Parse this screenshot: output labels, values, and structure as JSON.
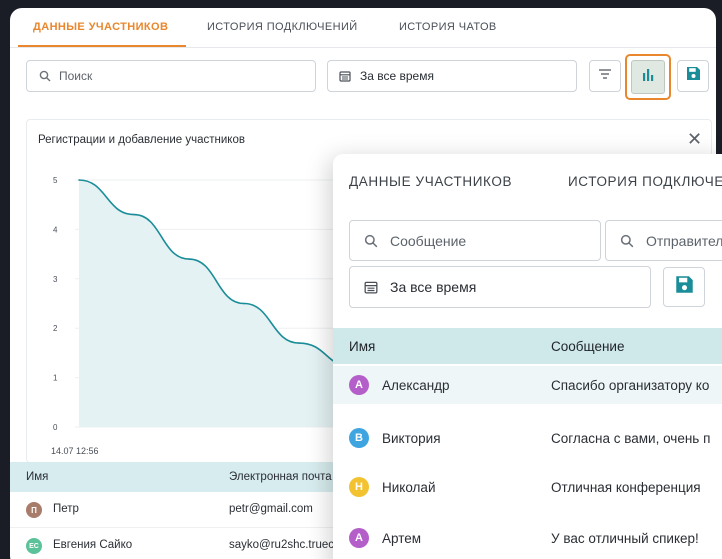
{
  "main_window": {
    "tabs": [
      {
        "label": "ДАННЫЕ УЧАСТНИКОВ",
        "active": true
      },
      {
        "label": "ИСТОРИЯ ПОДКЛЮЧЕНИЙ",
        "active": false
      },
      {
        "label": "ИСТОРИЯ ЧАТОВ",
        "active": false
      }
    ],
    "search": {
      "placeholder": "Поиск"
    },
    "period": {
      "value": "За все время"
    },
    "toolbar": {
      "filter_icon": "filter-lines-icon",
      "chart_icon": "bar-chart-icon",
      "save_icon": "save-disk-icon"
    },
    "chart": {
      "title": "Регистрации и добавление участников",
      "close_label": "✕",
      "y_ticks": [
        "5",
        "4",
        "3",
        "2",
        "1",
        "0"
      ],
      "x_first_label": "14.07 12:56"
    },
    "table": {
      "columns": [
        "Имя",
        "Электронная почта"
      ],
      "rows": [
        {
          "initials": "П",
          "name": "Петр",
          "email": "petr@gmail.com",
          "color": "#a87c6a"
        },
        {
          "initials": "ЕС",
          "name": "Евгения Сайко",
          "email": "sayko@ru2shc.truec",
          "color": "#5cc29a"
        }
      ]
    }
  },
  "chats_window": {
    "tabs": [
      {
        "label": "ДАННЫЕ УЧАСТНИКОВ"
      },
      {
        "label": "ИСТОРИЯ ПОДКЛЮЧЕН"
      }
    ],
    "message_search": {
      "placeholder": "Сообщение"
    },
    "sender_search": {
      "placeholder": "Отправител"
    },
    "period": {
      "value": "За все время"
    },
    "table": {
      "columns": [
        "Имя",
        "Сообщение"
      ],
      "rows": [
        {
          "initial": "А",
          "name": "Александр",
          "message": "Спасибо организатору ко",
          "color": "#b35ec9"
        },
        {
          "initial": "В",
          "name": "Виктория",
          "message": "Согласна с вами, очень п",
          "color": "#3fa5e0"
        },
        {
          "initial": "Н",
          "name": "Николай",
          "message": "Отличная конференция",
          "color": "#f2c230"
        },
        {
          "initial": "А",
          "name": "Артем",
          "message": "У вас отличный спикер!",
          "color": "#b35ec9"
        }
      ]
    }
  },
  "colors": {
    "accent_orange": "#e8872d",
    "teal": "#1b8d99",
    "header_teal_light": "#d7ecee"
  },
  "chart_data": {
    "type": "area",
    "title": "Регистрации и добавление участников",
    "xlabel": "",
    "ylabel": "",
    "ylim": [
      0,
      5
    ],
    "y_ticks": [
      0,
      1,
      2,
      3,
      4,
      5
    ],
    "x": [
      "14.07 12:56"
    ],
    "series": [
      {
        "values": [
          5,
          4.3,
          3.4,
          2.5,
          1.7,
          1.2
        ]
      }
    ]
  }
}
